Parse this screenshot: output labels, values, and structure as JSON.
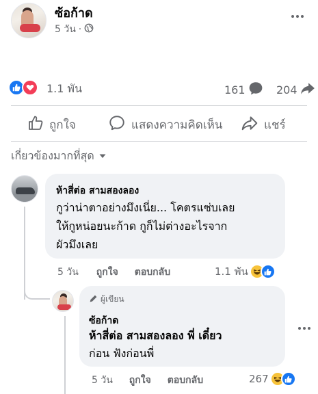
{
  "post": {
    "author": "ซ้อก้าด",
    "time": "5 วัน",
    "separator": "·",
    "audience_icon": "globe-icon",
    "more_icon": "more-horizontal-icon"
  },
  "stats": {
    "reactions": "1.1 พัน",
    "comments": "161",
    "shares": "204"
  },
  "actions": {
    "like": "ถูกใจ",
    "comment": "แสดงความคิดเห็น",
    "share": "แชร์"
  },
  "sort": {
    "label": "เกี่ยวข้องมากที่สุด"
  },
  "comment1": {
    "author": "ห้าสี่ต่อ สามสองลอง",
    "lines": [
      "กูว่าน่าตาอย่างมึงเนี่ย... โคตรแซ่บเลย",
      "ให้กูหน่อยนะก้าด กูก็ไม่ต่างอะไรจาก",
      "ผัวมึงเลย"
    ],
    "time": "5 วัน",
    "like": "ถูกใจ",
    "reply": "ตอบกลับ",
    "reactions": "1.1 พัน"
  },
  "reply1": {
    "badge": "ผู้เขียน",
    "author": "ซ้อก้าด",
    "lines": [
      "ห้าสี่ต่อ สามสองลอง พี่ เดี๋ยว",
      "ก่อน ฟังก่อนพี่"
    ],
    "time": "5 วัน",
    "like": "ถูกใจ",
    "reply": "ตอบกลับ",
    "reactions": "267"
  },
  "colors": {
    "accent": "#1877f2",
    "love": "#f33e58",
    "haha": "#f7c33b",
    "secondary_text": "#65676b",
    "bubble": "#f0f2f5"
  }
}
